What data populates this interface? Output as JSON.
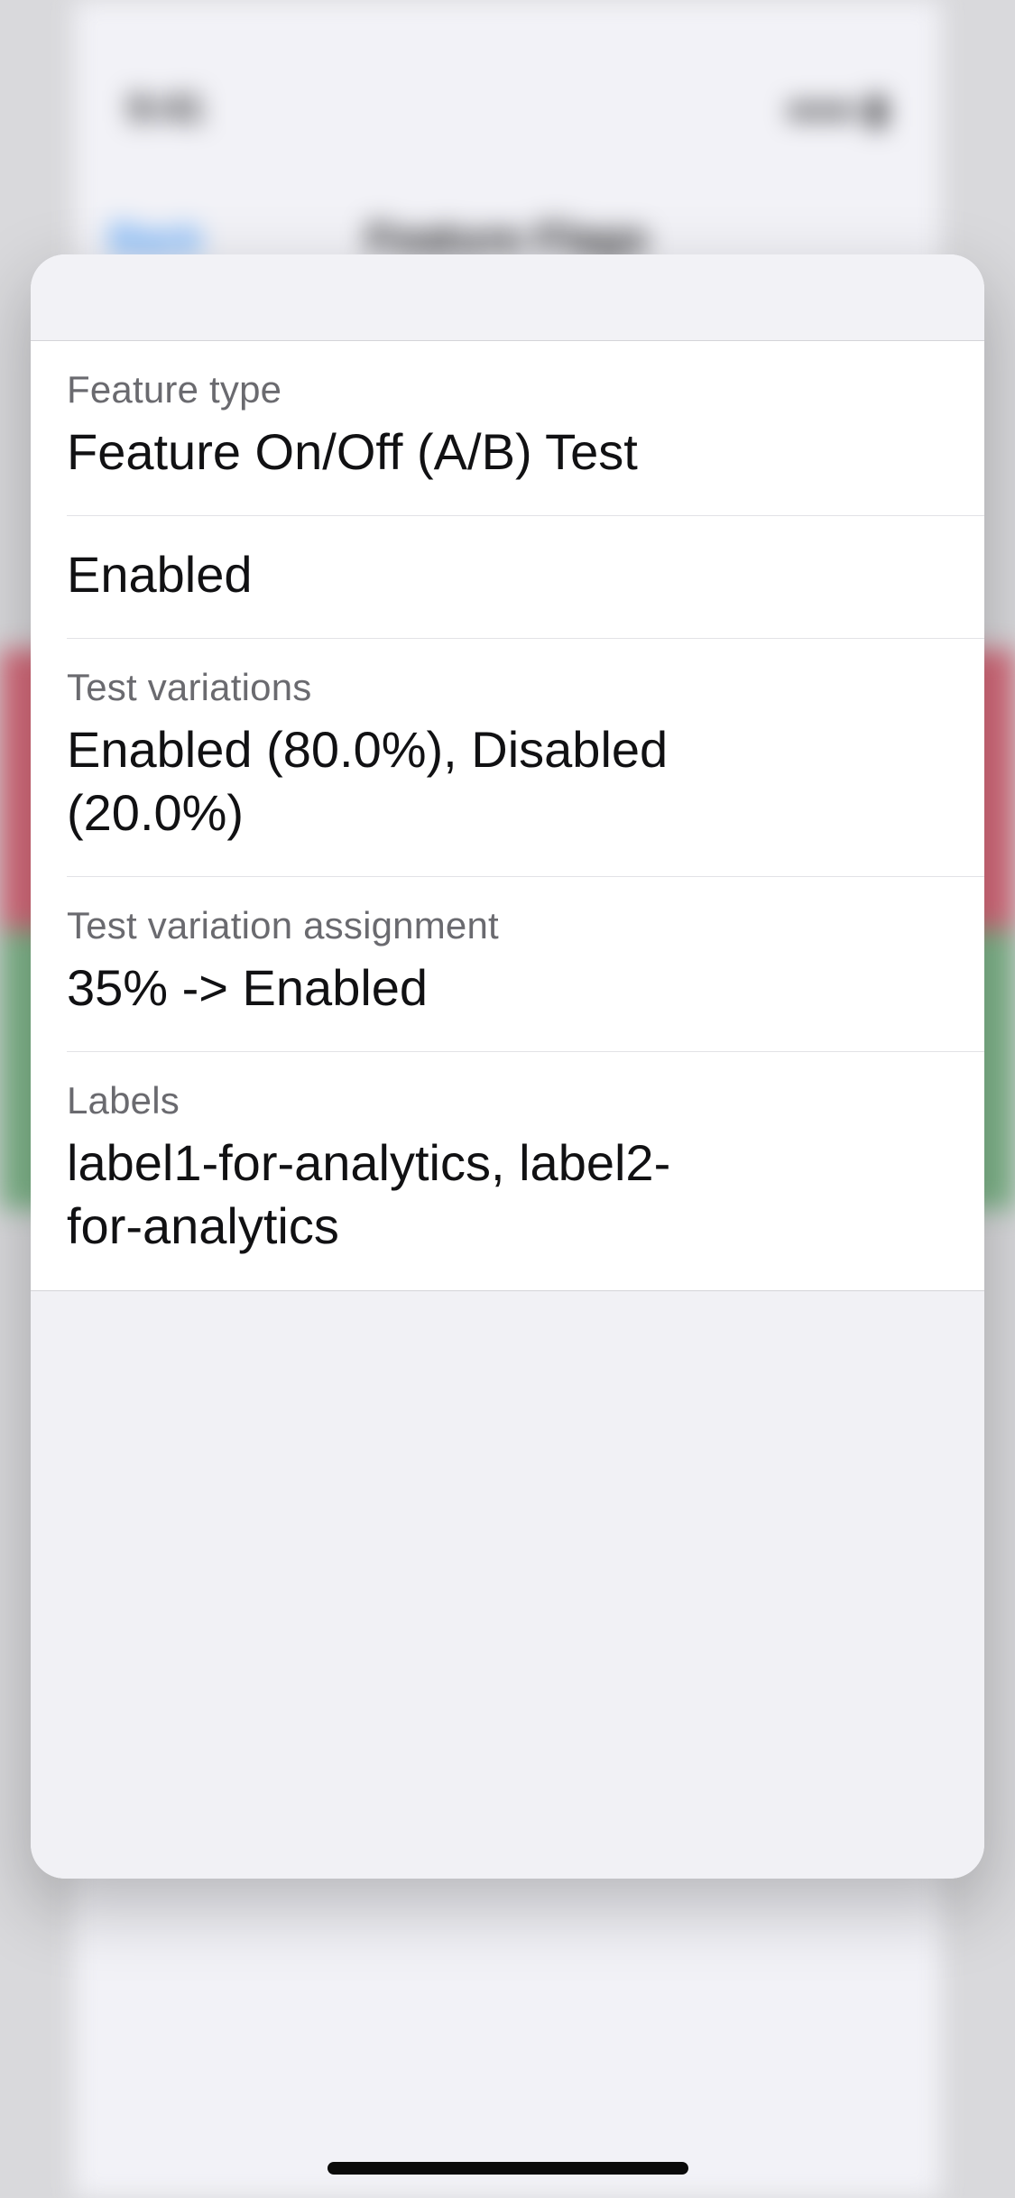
{
  "background": {
    "status_time": "9:41",
    "nav_back_label": "Back",
    "nav_title": "Feature Flags"
  },
  "sheet": {
    "rows": [
      {
        "label": "Feature type",
        "value": "Feature On/Off (A/B) Test"
      },
      {
        "label": "",
        "value": "Enabled"
      },
      {
        "label": "Test variations",
        "value": "Enabled (80.0%), Disabled (20.0%)"
      },
      {
        "label": "Test variation assignment",
        "value": "35% -> Enabled"
      },
      {
        "label": "Labels",
        "value": "label1-for-analytics, label2-for-analytics"
      }
    ]
  }
}
